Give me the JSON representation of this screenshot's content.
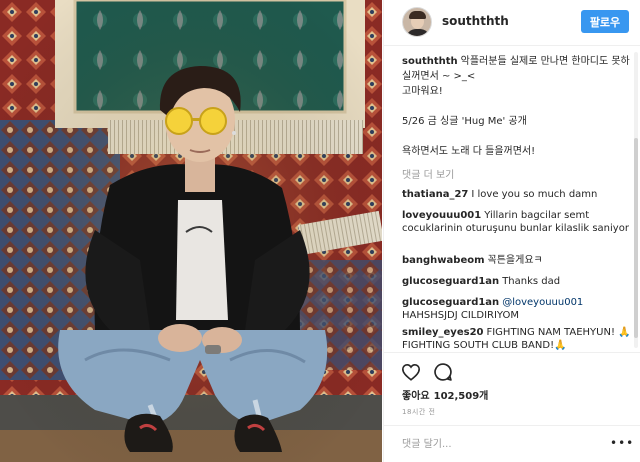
{
  "post": {
    "photo_alt": "Photo of a man wearing yellow round sunglasses crouching in front of hanging Persian rugs"
  },
  "header": {
    "username": "souththth",
    "follow_label": "팔로우"
  },
  "caption": {
    "username": "souththth",
    "line1": "악플러분들 실제로 만나면 한마디도 못하실꺼면서 ~ >_<",
    "line2": "고마워요!",
    "line3": "5/26 금 싱글 'Hug Me' 공개",
    "line4": "욕하면서도 노래 다 들을꺼면서!"
  },
  "load_more": "댓글 더 보기",
  "comments": [
    {
      "username": "thatiana_27",
      "text": "I love you so much damn"
    },
    {
      "username": "loveyouuu001",
      "text": "Yillarin bagcilar semt cocuklarinin oturuşunu bunlar kilaslik saniyor"
    },
    {
      "username": "banghwabeom",
      "text": "꼭튼을게요ㅋ"
    },
    {
      "username": "glucoseguard1an",
      "text": "Thanks dad"
    },
    {
      "username": "glucoseguard1an",
      "mention": "@loveyouuu001",
      "text": "HAHSHSJDJ CILDIRIYOM"
    },
    {
      "username": "smiley_eyes20",
      "text": "FIGHTING NAM TAEHYUN! 🙏 FIGHTING SOUTH CLUB BAND!🙏"
    }
  ],
  "likes": {
    "label": "좋아요",
    "count": "102,509개"
  },
  "timestamp": "18시간 전",
  "add_comment": {
    "placeholder": "댓글 달기...",
    "more": "•••"
  },
  "colors": {
    "accent": "#3897f0",
    "text": "#262626",
    "muted": "#999999",
    "border": "#efefef"
  },
  "icons": [
    "heart-icon",
    "comment-icon",
    "more-options-icon"
  ]
}
